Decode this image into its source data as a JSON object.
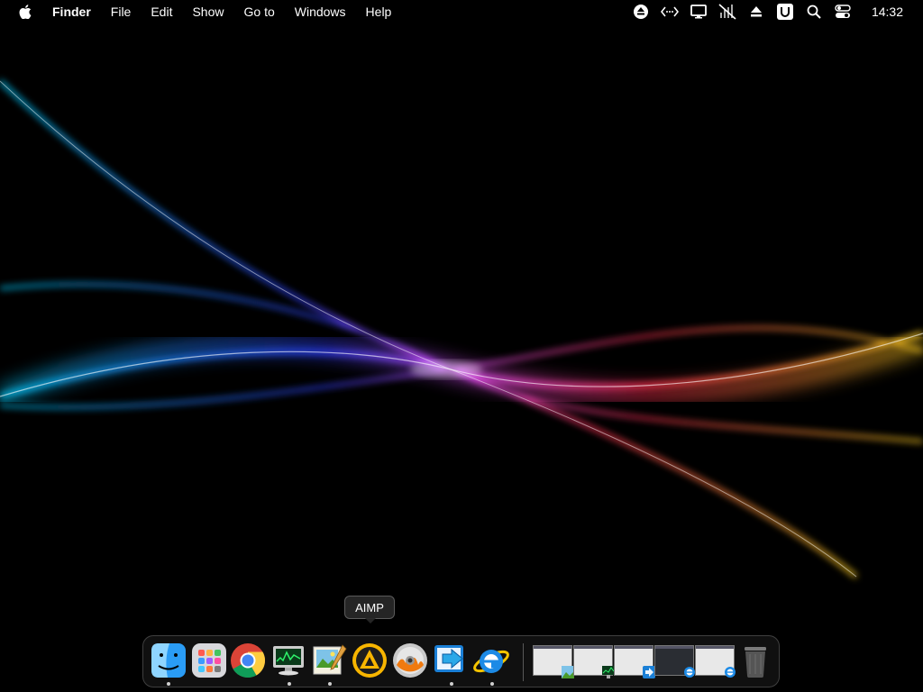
{
  "menubar": {
    "apple_icon": "apple-logo-icon",
    "items": [
      "Finder",
      "File",
      "Edit",
      "Show",
      "Go to",
      "Windows",
      "Help"
    ],
    "status_icons": [
      "eject-circle-icon",
      "code-arrows-icon",
      "display-icon",
      "muted-network-icon",
      "eject-icon",
      "u-box-icon",
      "search-icon",
      "control-center-icon"
    ],
    "clock": "14:32"
  },
  "tooltip": {
    "label": "AIMP"
  },
  "dock": {
    "apps": [
      {
        "name": "Finder",
        "icon": "finder-icon",
        "running": true
      },
      {
        "name": "Launchpad",
        "icon": "launchpad-icon",
        "running": false
      },
      {
        "name": "Google Chrome",
        "icon": "chrome-icon",
        "running": false
      },
      {
        "name": "Activity Monitor",
        "icon": "activity-monitor-icon",
        "running": true
      },
      {
        "name": "Image Editor",
        "icon": "image-editor-icon",
        "running": true
      },
      {
        "name": "AIMP",
        "icon": "aimp-icon",
        "running": false
      },
      {
        "name": "Disc Burner",
        "icon": "disc-burner-icon",
        "running": false
      },
      {
        "name": "Remote Desktop",
        "icon": "remote-desktop-icon",
        "running": true
      },
      {
        "name": "Internet Explorer",
        "icon": "internet-explorer-icon",
        "running": true
      }
    ],
    "minimized_windows": [
      "window-thumbnail-1",
      "window-thumbnail-2",
      "window-thumbnail-3",
      "window-thumbnail-4",
      "window-thumbnail-5"
    ],
    "trash_icon": "trash-icon"
  },
  "colors": {
    "wallpaper_bg": "#000000",
    "wave_blue": "#2f4dff",
    "wave_cyan": "#11c6ff",
    "wave_pink": "#ff3fd0",
    "wave_orange": "#ff8a1a",
    "wave_yellow": "#ffd21a"
  }
}
